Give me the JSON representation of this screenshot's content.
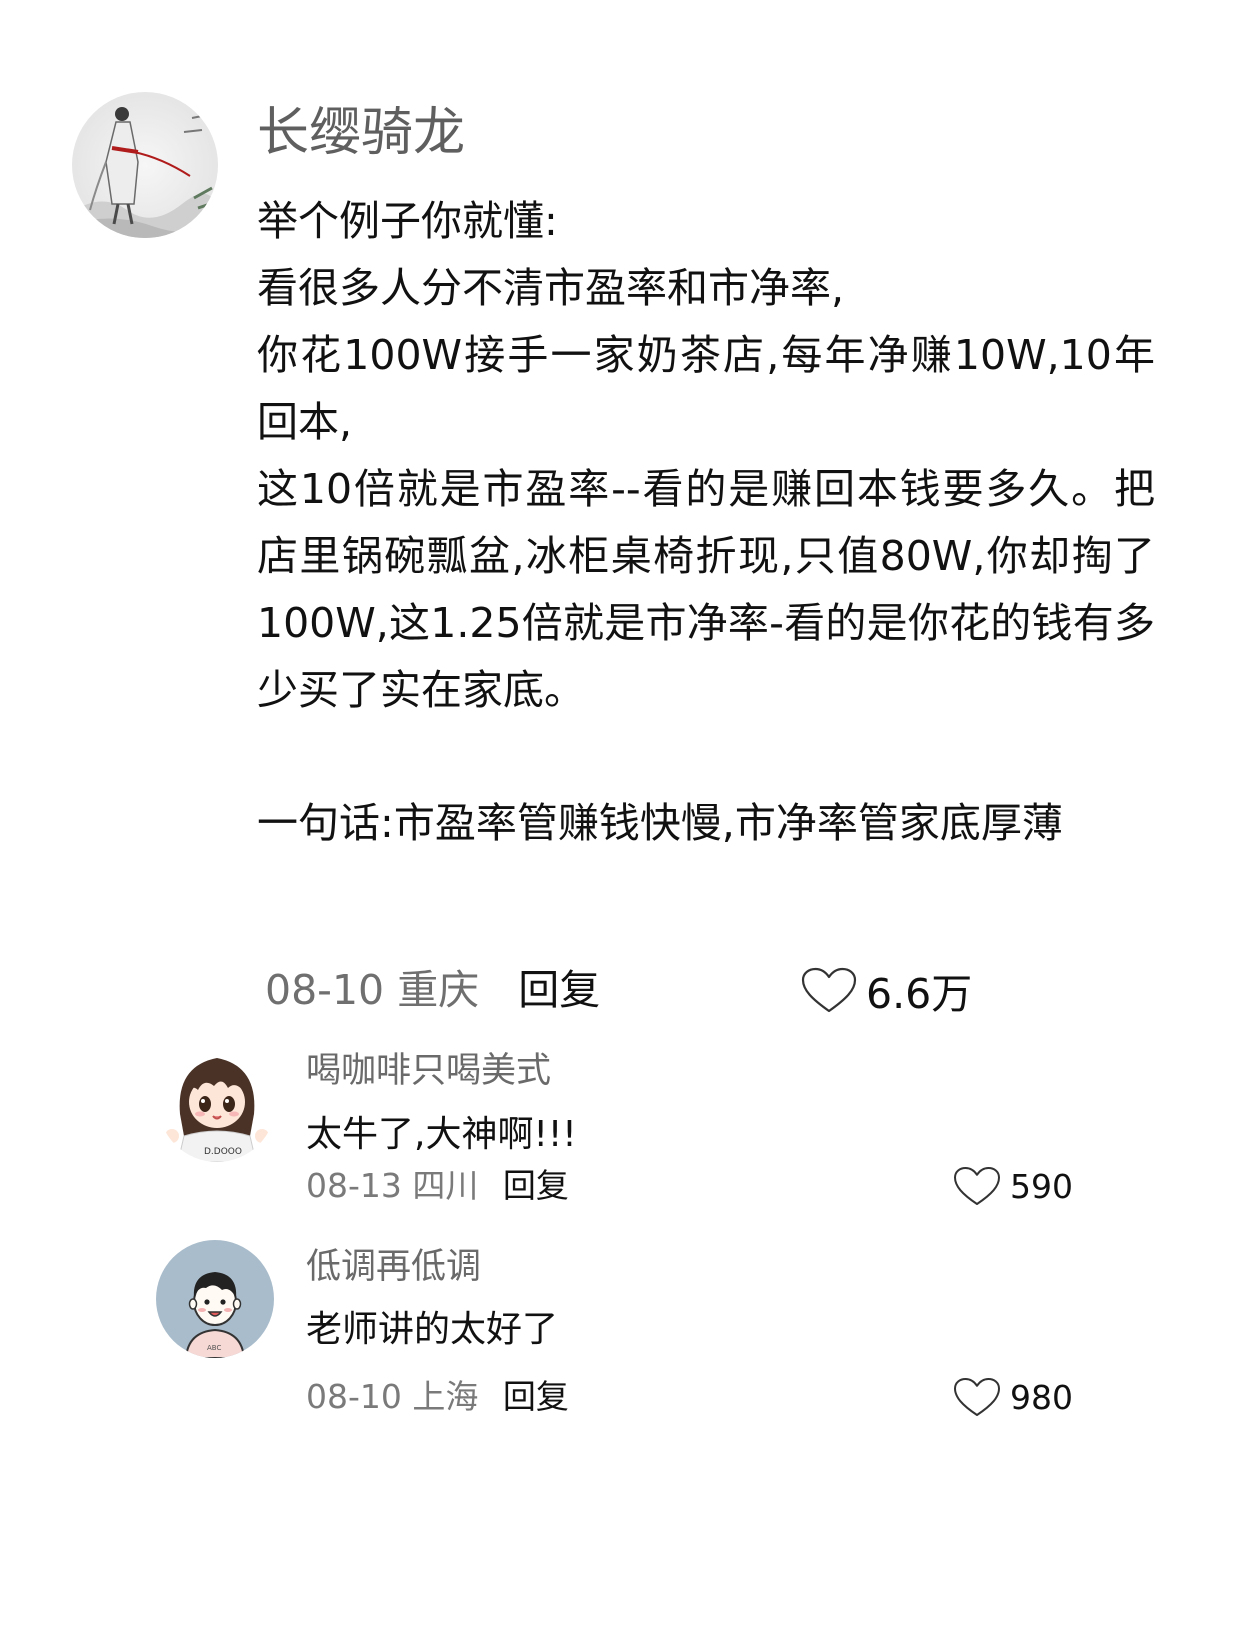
{
  "main_comment": {
    "avatar_icon": "ink-painting-swordsman-avatar",
    "author": "长缨骑龙",
    "paragraphs": [
      "举个例子你就懂:",
      "看很多人分不清市盈率和市净率,",
      "你花100W接手一家奶茶店,每年净赚10W,10年回本,",
      "这10倍就是市盈率--看的是赚回本钱要多久。把店里锅碗瓢盆,冰柜桌椅折现,只值80W,你却掏了100W,这1.25倍就是市净率-看的是你花的钱有多少买了实在家底。",
      "一句话:市盈率管赚钱快慢,市净率管家底厚薄"
    ],
    "date": "08-10",
    "location": "重庆",
    "reply_label": "回复",
    "like_icon": "heart-outline-icon",
    "likes": "6.6万"
  },
  "replies": [
    {
      "avatar_icon": "cartoon-girl-avatar",
      "author": "喝咖啡只喝美式",
      "text": "太牛了,大神啊!!!",
      "date": "08-13",
      "location": "四川",
      "reply_label": "回复",
      "like_icon": "heart-outline-icon",
      "likes": "590"
    },
    {
      "avatar_icon": "cartoon-boy-avatar",
      "author": "低调再低调",
      "text": "老师讲的太好了",
      "date": "08-10",
      "location": "上海",
      "reply_label": "回复",
      "like_icon": "heart-outline-icon",
      "likes": "980"
    }
  ],
  "colors": {
    "background": "#ffffff",
    "text_primary": "#111111",
    "text_secondary": "#6f6f6f",
    "boy_avatar_bg": "#a9bccb"
  }
}
